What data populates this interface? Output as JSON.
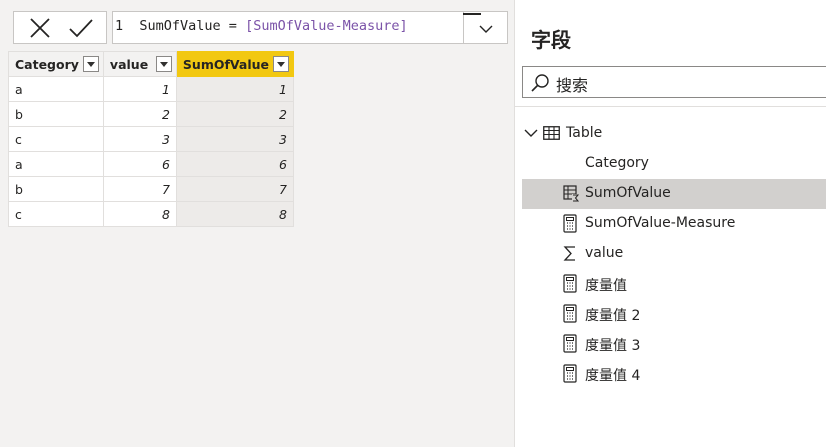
{
  "formula_bar": {
    "line_number": "1",
    "expression_prefix": "SumOfValue = ",
    "expression_ref": "[SumOfValue-Measure]",
    "cancel_icon": "close-icon",
    "commit_icon": "checkmark-icon",
    "expand_icon": "chevron-down-icon"
  },
  "grid": {
    "columns": [
      "Category",
      "value",
      "SumOfValue"
    ],
    "selected_column": "SumOfValue",
    "rows": [
      [
        "a",
        "1",
        "1"
      ],
      [
        "b",
        "2",
        "2"
      ],
      [
        "c",
        "3",
        "3"
      ],
      [
        "a",
        "6",
        "6"
      ],
      [
        "b",
        "7",
        "7"
      ],
      [
        "c",
        "8",
        "8"
      ]
    ]
  },
  "fields_pane": {
    "title": "字段",
    "search_placeholder": "搜索",
    "table": {
      "name": "Table",
      "icon": "table-icon",
      "expanded": true
    },
    "fields": [
      {
        "label": "Category",
        "icon": ""
      },
      {
        "label": "SumOfValue",
        "icon": "calculated-column-icon",
        "selected": true
      },
      {
        "label": "SumOfValue-Measure",
        "icon": "calculator-icon"
      },
      {
        "label": "value",
        "icon": "sigma-icon"
      },
      {
        "label": "度量值",
        "icon": "calculator-icon"
      },
      {
        "label": "度量值 2",
        "icon": "calculator-icon"
      },
      {
        "label": "度量值 3",
        "icon": "calculator-icon"
      },
      {
        "label": "度量值 4",
        "icon": "calculator-icon"
      }
    ]
  },
  "colors": {
    "selected_header": "#f2c811",
    "selected_field_row": "#d2d0ce",
    "measure_ref_text": "#7b53a8"
  }
}
